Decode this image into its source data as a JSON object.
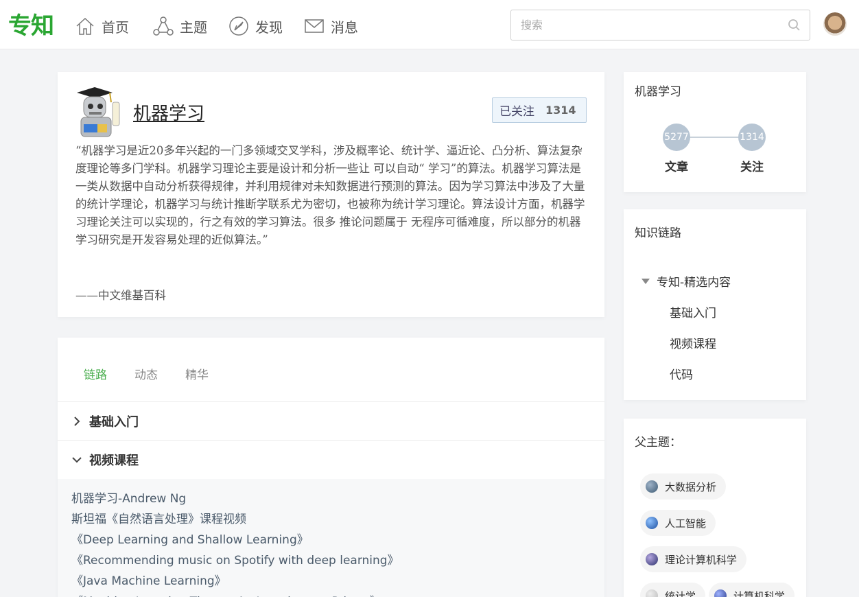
{
  "brand": {
    "logo_text": "专知",
    "accent": "#2aa632"
  },
  "nav": {
    "items": [
      {
        "label": "首页",
        "icon": "home-icon"
      },
      {
        "label": "主题",
        "icon": "topic-icon"
      },
      {
        "label": "发现",
        "icon": "compass-icon"
      },
      {
        "label": "消息",
        "icon": "mail-icon"
      }
    ],
    "search_placeholder": "搜索"
  },
  "topic": {
    "title": "机器学习",
    "follow_label": "已关注",
    "follow_count": "1314",
    "description": "“机器学习是近20多年兴起的一门多领域交叉学科，涉及概率论、统计学、逼近论、凸分析、算法复杂度理论等多门学科。机器学习理论主要是设计和分析一些让 可以自动“ 学习”的算法。机器学习算法是一类从数据中自动分析获得规律，并利用规律对未知数据进行预测的算法。因为学习算法中涉及了大量的统计学理论，机器学习与统计推断学联系尤为密切，也被称为统计学习理论。算法设计方面，机器学习理论关注可以实现的，行之有效的学习算法。很多 推论问题属于 无程序可循难度，所以部分的机器学习研究是开发容易处理的近似算法。”",
    "source": "——中文维基百科"
  },
  "tabs": [
    {
      "label": "链路",
      "active": true
    },
    {
      "label": "动态",
      "active": false
    },
    {
      "label": "精华",
      "active": false
    }
  ],
  "sections": [
    {
      "label": "基础入门",
      "expanded": false
    },
    {
      "label": "视频课程",
      "expanded": true
    }
  ],
  "links": [
    "机器学习-Andrew Ng",
    "斯坦福《自然语言处理》课程视频",
    "《Deep Learning and Shallow Learning》",
    "《Recommending music on Spotify with deep learning》",
    "《Java Machine Learning》",
    "《Machine Learning Theory: An Introductory Primer》"
  ],
  "side_stats": {
    "title": "机器学习",
    "articles_value": "5277",
    "articles_label": "文章",
    "followers_value": "1314",
    "followers_label": "关注"
  },
  "knowledge_chain": {
    "title": "知识链路",
    "root": "专知-精选内容",
    "children": [
      "基础入门",
      "视频课程",
      "代码"
    ]
  },
  "parent_topics": {
    "title": "父主题：",
    "chips": [
      "大数据分析",
      "人工智能",
      "理论计算机科学",
      "统计学",
      "计算机科学"
    ]
  }
}
